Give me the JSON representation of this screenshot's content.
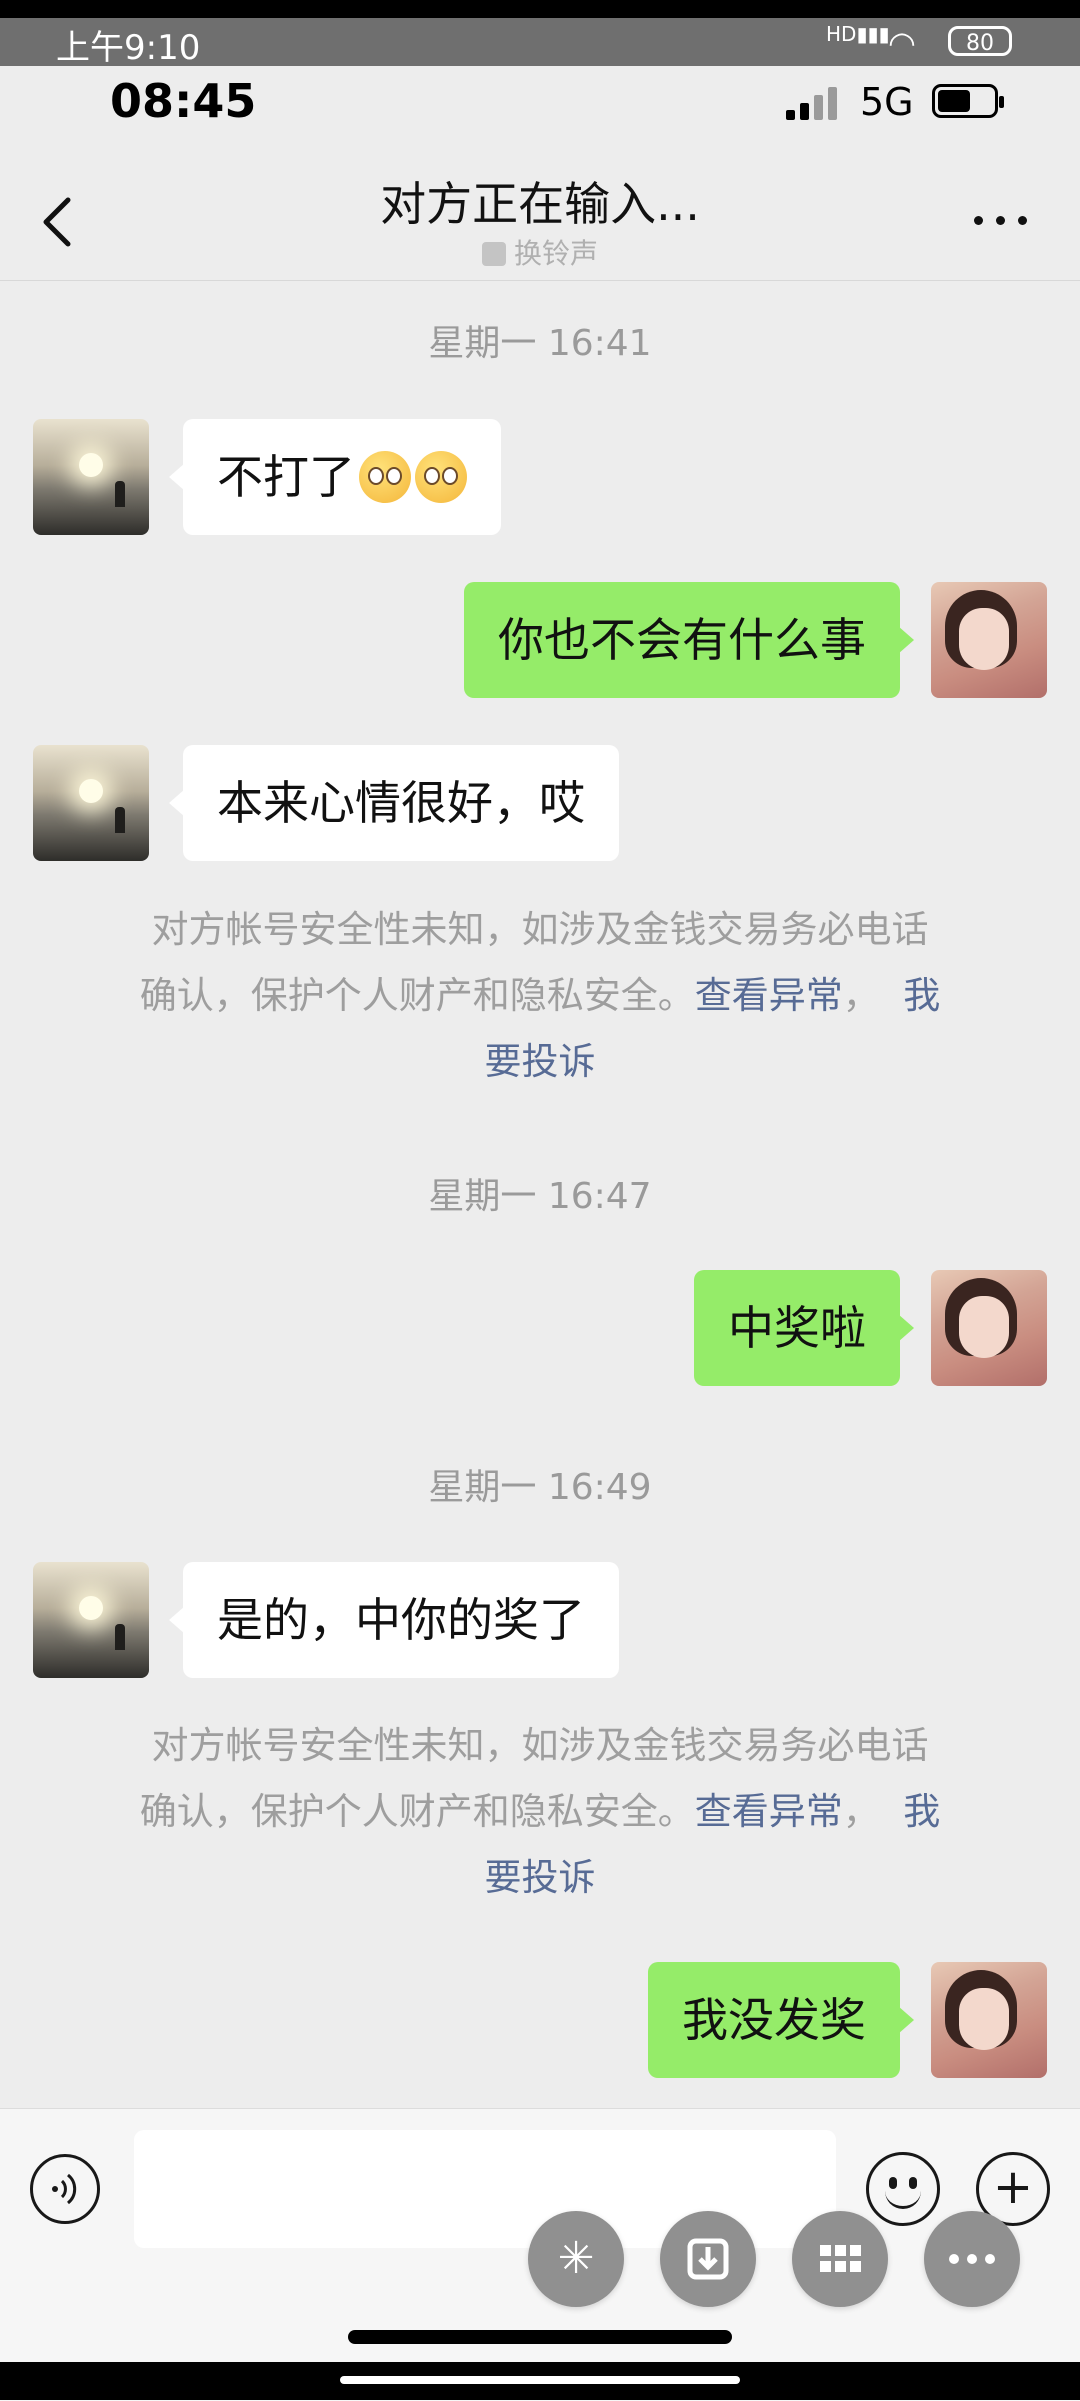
{
  "outer_status": {
    "time": "上午9:10",
    "battery": "80"
  },
  "status_bar": {
    "time": "08:45",
    "network": "5G"
  },
  "header": {
    "title": "对方正在输入...",
    "subtitle": "换铃声"
  },
  "messages": [
    {
      "type": "timestamp",
      "text": "星期一 16:41"
    },
    {
      "type": "left",
      "text": "不打了",
      "emoji_count": 2
    },
    {
      "type": "right",
      "text": "你也不会有什么事"
    },
    {
      "type": "left",
      "text": "本来心情很好，哎"
    },
    {
      "type": "notice",
      "line1": "对方帐号安全性未知，如涉及金钱交易务必电话",
      "line2_prefix": "确认，保护个人财产和隐私安全。",
      "link_view": "查看异常",
      "sep": "，",
      "link_report_1": "我",
      "link_report_2": "要投诉"
    },
    {
      "type": "timestamp",
      "text": "星期一 16:47"
    },
    {
      "type": "right",
      "text": "中奖啦"
    },
    {
      "type": "timestamp",
      "text": "星期一 16:49"
    },
    {
      "type": "left",
      "text": "是的，中你的奖了"
    },
    {
      "type": "notice",
      "line1": "对方帐号安全性未知，如涉及金钱交易务必电话",
      "line2_prefix": "确认，保护个人财产和隐私安全。",
      "link_view": "查看异常",
      "sep": "，",
      "link_report_1": "我",
      "link_report_2": "要投诉"
    },
    {
      "type": "right",
      "text": "我没发奖"
    }
  ],
  "input": {
    "value": "",
    "placeholder": ""
  },
  "icons": {
    "voice": "voice-icon",
    "emoji": "emoji-icon",
    "plus": "plus-icon",
    "floating": [
      "asterisk-icon",
      "download-icon",
      "grid-icon",
      "more-icon"
    ]
  }
}
